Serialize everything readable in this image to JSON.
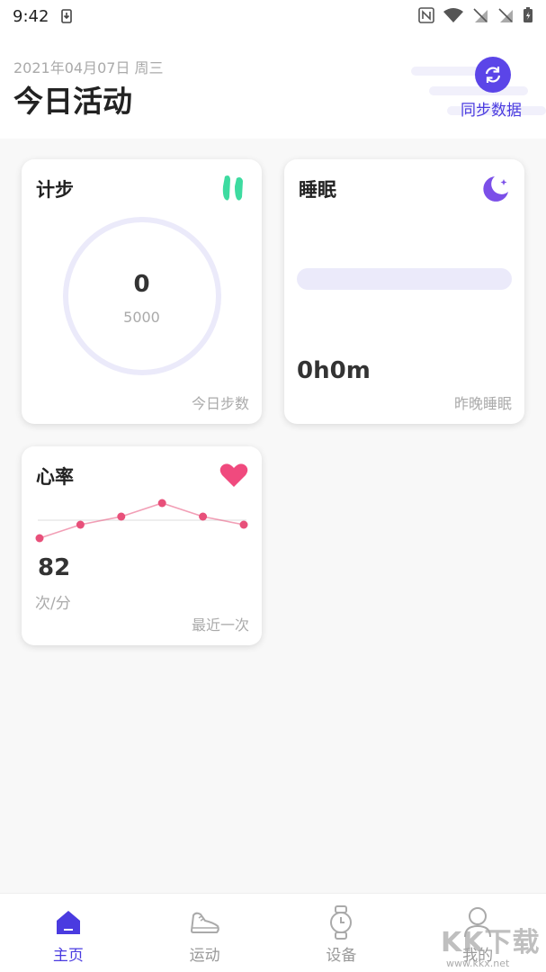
{
  "status_bar": {
    "time": "9:42",
    "icons": [
      "download-icon",
      "nfc-icon",
      "wifi-icon",
      "no-sim-icon",
      "no-sim-icon",
      "battery-icon"
    ]
  },
  "header": {
    "date": "2021年04月07日 周三",
    "title": "今日活动",
    "sync_label": "同步数据",
    "accent_color": "#5b45e8"
  },
  "steps": {
    "title": "计步",
    "value": "0",
    "goal": "5000",
    "footer": "今日步数",
    "progress": 0,
    "icon": "footprints-icon"
  },
  "sleep": {
    "title": "睡眠",
    "value": "0h0m",
    "footer": "昨晚睡眠",
    "icon": "moon-icon"
  },
  "heart_rate": {
    "title": "心率",
    "value": "82",
    "unit": "次/分",
    "footer": "最近一次",
    "icon": "heart-icon",
    "line_color": "#e8507a"
  },
  "chart_data": {
    "type": "line",
    "series": [
      {
        "values": [
          0,
          0.5,
          0.8,
          1.3,
          0.8,
          0.5
        ]
      }
    ]
  },
  "nav": {
    "items": [
      {
        "label": "主页",
        "icon": "home-icon",
        "active": true
      },
      {
        "label": "运动",
        "icon": "shoe-icon",
        "active": false
      },
      {
        "label": "设备",
        "icon": "watch-icon",
        "active": false
      },
      {
        "label": "我的",
        "icon": "person-icon",
        "active": false
      }
    ]
  },
  "watermark": {
    "main": "KK下载",
    "sub": "www.kkx.net"
  }
}
